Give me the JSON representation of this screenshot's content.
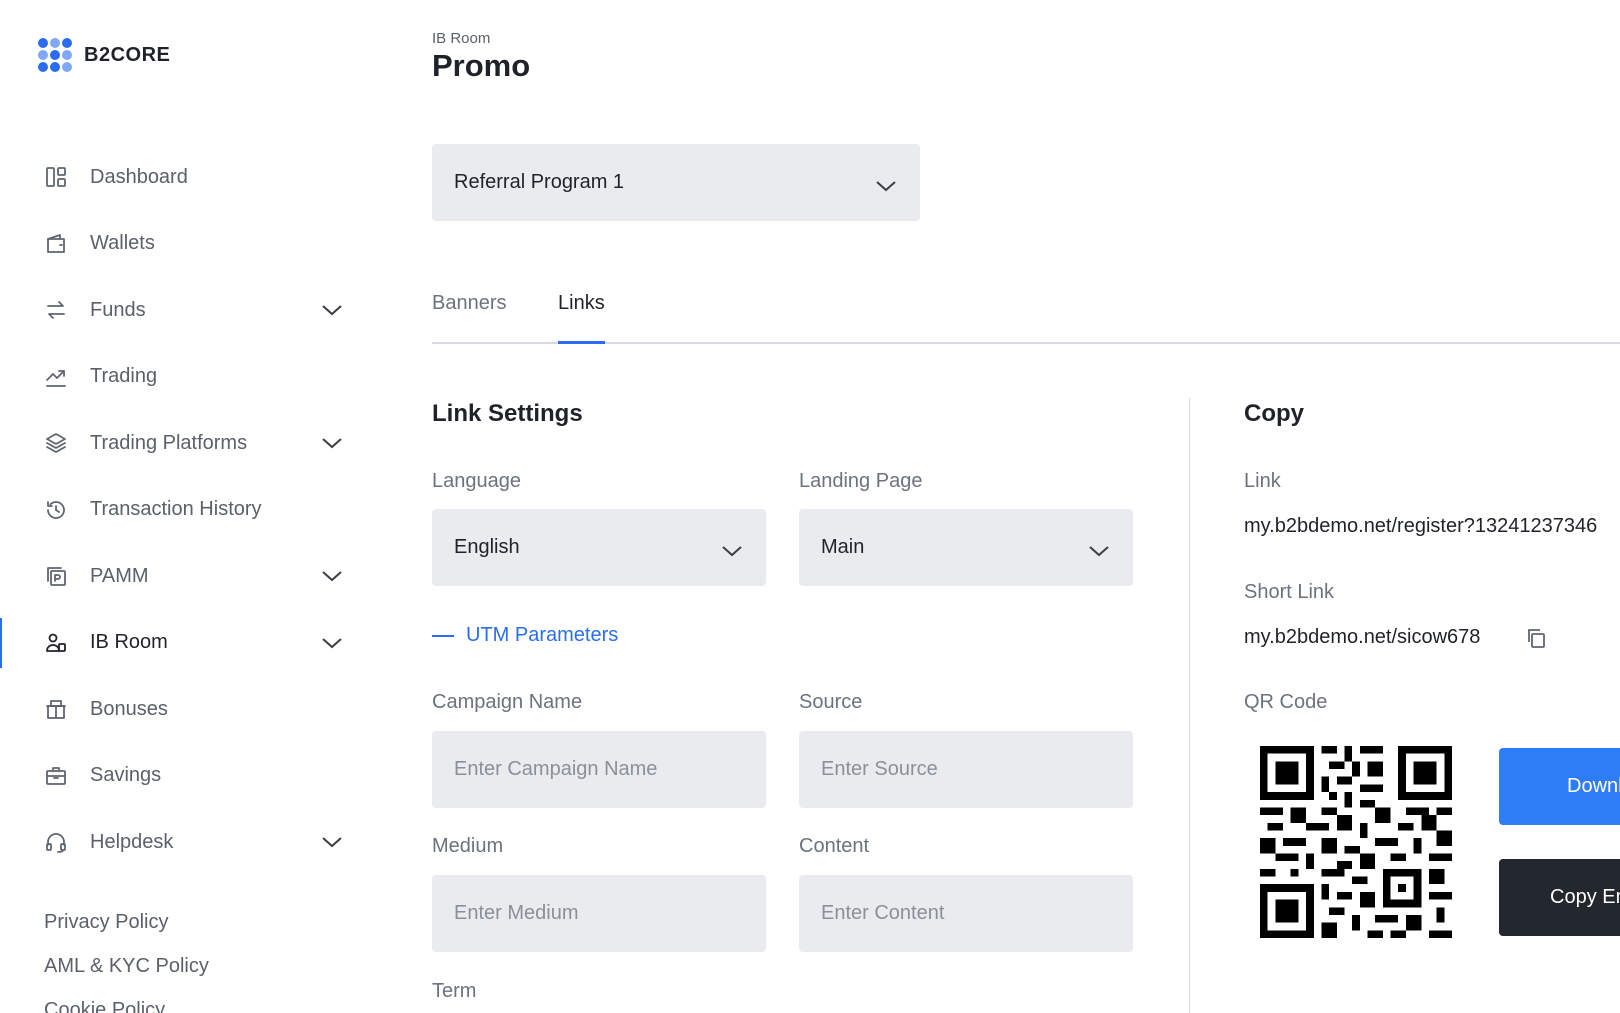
{
  "brand": {
    "name": "B2CORE",
    "accent": "#2a6df4"
  },
  "sidebar": {
    "items": [
      {
        "label": "Dashboard",
        "icon": "dashboard-icon",
        "expandable": false
      },
      {
        "label": "Wallets",
        "icon": "wallet-icon",
        "expandable": false
      },
      {
        "label": "Funds",
        "icon": "transfer-arrows-icon",
        "expandable": true
      },
      {
        "label": "Trading",
        "icon": "trending-up-icon",
        "expandable": false
      },
      {
        "label": "Trading Platforms",
        "icon": "layers-icon",
        "expandable": true
      },
      {
        "label": "Transaction History",
        "icon": "history-icon",
        "expandable": false
      },
      {
        "label": "PAMM",
        "icon": "pamm-icon",
        "expandable": true
      },
      {
        "label": "IB Room",
        "icon": "ib-room-icon",
        "expandable": true,
        "active": true
      },
      {
        "label": "Bonuses",
        "icon": "gift-icon",
        "expandable": false
      },
      {
        "label": "Savings",
        "icon": "briefcase-icon",
        "expandable": false
      },
      {
        "label": "Helpdesk",
        "icon": "headset-icon",
        "expandable": true
      }
    ],
    "footer_links": [
      "Privacy Policy",
      "AML & KYC Policy",
      "Cookie Policy"
    ]
  },
  "header": {
    "breadcrumb": "IB Room",
    "title": "Promo"
  },
  "program_select": {
    "value": "Referral Program 1"
  },
  "tabs": [
    {
      "label": "Banners",
      "active": false
    },
    {
      "label": "Links",
      "active": true
    }
  ],
  "link_settings": {
    "title": "Link Settings",
    "language": {
      "label": "Language",
      "value": "English"
    },
    "landing_page": {
      "label": "Landing Page",
      "value": "Main"
    },
    "utm_toggle": "UTM Parameters",
    "campaign_name": {
      "label": "Campaign Name",
      "placeholder": "Enter Campaign Name"
    },
    "source": {
      "label": "Source",
      "placeholder": "Enter Source"
    },
    "medium": {
      "label": "Medium",
      "placeholder": "Enter Medium"
    },
    "content": {
      "label": "Content",
      "placeholder": "Enter Content"
    },
    "term": {
      "label": "Term"
    }
  },
  "copy": {
    "title": "Copy",
    "link_label": "Link",
    "link_value": "my.b2bdemo.net/register?13241237346",
    "short_link_label": "Short Link",
    "short_link_value": "my.b2bdemo.net/sicow678",
    "qr_label": "QR Code",
    "download_button": "Download",
    "copy_embed_button": "Copy Embed Code"
  }
}
